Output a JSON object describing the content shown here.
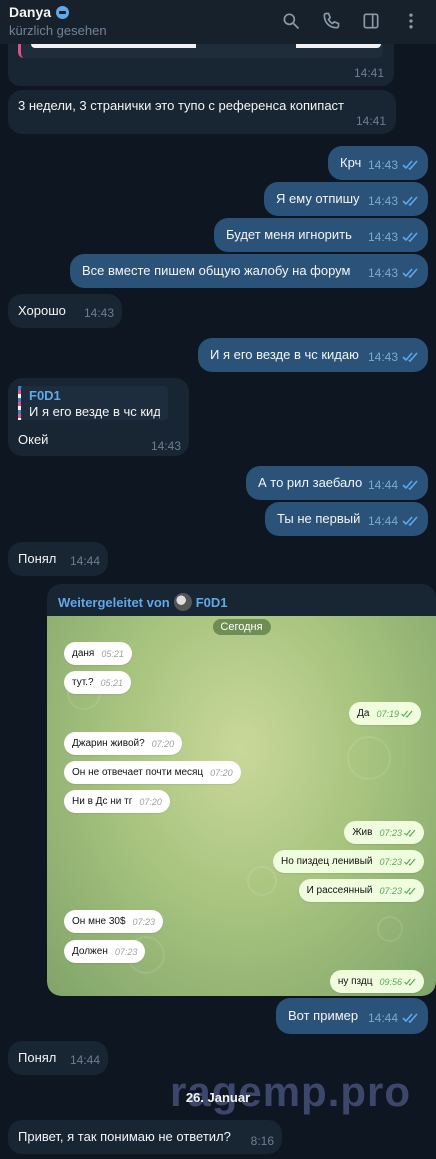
{
  "header": {
    "contact_name": "Danya",
    "status": "kürzlich gesehen",
    "icons": [
      "search-icon",
      "phone-icon",
      "sidebar-toggle-icon",
      "more-icon"
    ]
  },
  "messages": [
    {
      "id": "m0",
      "dir": "in",
      "text": "",
      "time": "14:41"
    },
    {
      "id": "m1",
      "dir": "in",
      "text": "3 недели, 3 странички это тупо с референса копипаст",
      "time": "14:41"
    },
    {
      "id": "m2",
      "dir": "out",
      "text": "Крч",
      "time": "14:43"
    },
    {
      "id": "m3",
      "dir": "out",
      "text": "Я ему отпишу",
      "time": "14:43"
    },
    {
      "id": "m4",
      "dir": "out",
      "text": "Будет меня игнорить",
      "time": "14:43"
    },
    {
      "id": "m5",
      "dir": "out",
      "text": "Все вместе пишем общую жалобу на форум",
      "time": "14:43"
    },
    {
      "id": "m6",
      "dir": "in",
      "text": "Хорошо",
      "time": "14:43"
    },
    {
      "id": "m7",
      "dir": "out",
      "text": "И я его везде в чс кидаю",
      "time": "14:43"
    },
    {
      "id": "m8",
      "dir": "in",
      "reply_name": "F0D1",
      "reply_text": "И я его везде в чс кид...",
      "text": "Окей",
      "time": "14:43"
    },
    {
      "id": "m9",
      "dir": "out",
      "text": "А то рил заебало",
      "time": "14:44"
    },
    {
      "id": "m10",
      "dir": "out",
      "text": "Ты не первый",
      "time": "14:44"
    },
    {
      "id": "m11",
      "dir": "in",
      "text": "Понял",
      "time": "14:44"
    },
    {
      "id": "m12",
      "dir": "out",
      "text": "Вот пример",
      "time": "14:44"
    },
    {
      "id": "m13",
      "dir": "in",
      "text": "Понял",
      "time": "14:44"
    },
    {
      "id": "m14",
      "dir": "in",
      "text": "Привет, я так понимаю не ответил?",
      "time": "8:16"
    }
  ],
  "forwarded": {
    "prefix": "Weitergeleitet von",
    "from": "F0D1",
    "screenshot": {
      "date_label": "Сегодня",
      "messages": [
        {
          "dir": "in",
          "text": "даня",
          "time": "05:21"
        },
        {
          "dir": "in",
          "text": "тут.?",
          "time": "05:21"
        },
        {
          "dir": "out",
          "text": "Да",
          "time": "07:19"
        },
        {
          "dir": "in",
          "text": "Джарин живой?",
          "time": "07:20"
        },
        {
          "dir": "in",
          "text": "Он не отвечает почти месяц",
          "time": "07:20"
        },
        {
          "dir": "in",
          "text": "Ни в Дс ни тг",
          "time": "07:20"
        },
        {
          "dir": "out",
          "text": "Жив",
          "time": "07:23"
        },
        {
          "dir": "out",
          "text": "Но пиздец ленивый",
          "time": "07:23"
        },
        {
          "dir": "out",
          "text": "И рассеянный",
          "time": "07:23"
        },
        {
          "dir": "in",
          "text": "Он мне 30$",
          "time": "07:23"
        },
        {
          "dir": "in",
          "text": "Должен",
          "time": "07:23"
        },
        {
          "dir": "out",
          "text": "ну пздц",
          "time": "09:56"
        }
      ]
    }
  },
  "date_separator": "26. Januar",
  "watermark": "ragemp.pro",
  "colors": {
    "background": "#0e1621",
    "incoming": "#182533",
    "outgoing": "#2b5278",
    "accent": "#5fa8ea"
  }
}
